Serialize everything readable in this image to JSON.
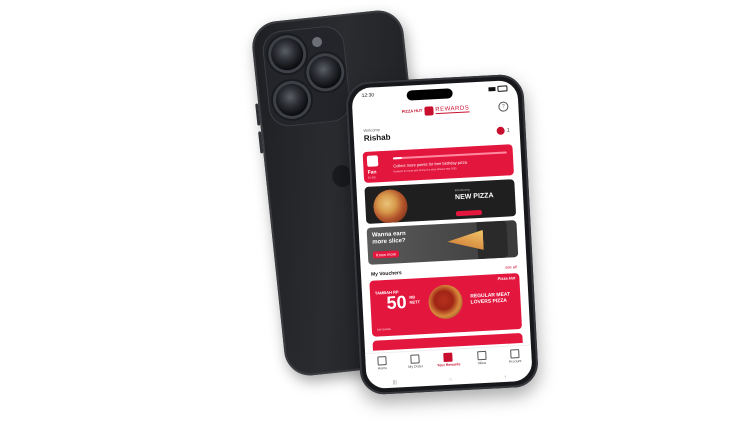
{
  "status_bar": {
    "time": "12:30"
  },
  "brand": {
    "top_text": "PIZZA HUT",
    "logo_text": "REWARDS"
  },
  "greeting": {
    "welcome": "Welcome",
    "name": "Rishab",
    "points": "1"
  },
  "progress_card": {
    "level": "Fan",
    "points_text": "0 / 60",
    "title": "Collect more points for free birthday pizza",
    "subtitle": "Redeem for more with 50 free for all to Wizard Year 2025",
    "progress": 0.08
  },
  "banner_pizza": {
    "small_text": "Introducing",
    "headline": "NEW PIZZA"
  },
  "banner_slice": {
    "headline": "Wanna earn more slice?",
    "button_label": "Know more"
  },
  "vouchers": {
    "title": "My Vouchers",
    "see_all": "see all",
    "card": {
      "brand": "Pizza Hut",
      "promo": "TAMBAH RP",
      "amount": "50",
      "unit": "RB NETT",
      "product": "REGULAR MEAT LOVERS PIZZA",
      "fine_print": "S&K Berlaku"
    }
  },
  "bottom_nav": [
    {
      "label": "Home",
      "icon": "home-icon",
      "active": false
    },
    {
      "label": "My Order",
      "icon": "order-icon",
      "active": false
    },
    {
      "label": "Your Rewards",
      "icon": "rewards-icon",
      "active": true
    },
    {
      "label": "Inbox",
      "icon": "inbox-icon",
      "active": false
    },
    {
      "label": "Account",
      "icon": "account-icon",
      "active": false
    }
  ],
  "colors": {
    "accent": "#e3173e",
    "brand_red": "#c8102e",
    "phone_body": "#1d1f22"
  }
}
